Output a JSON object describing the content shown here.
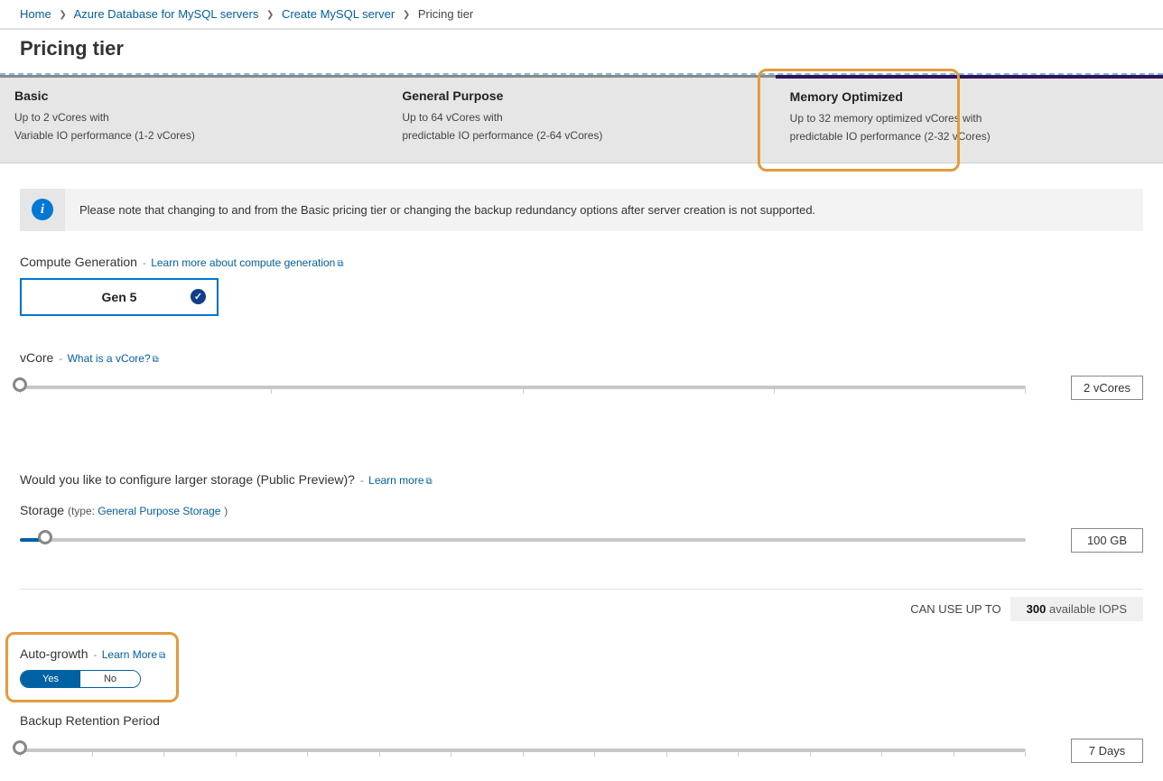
{
  "breadcrumb": {
    "items": [
      "Home",
      "Azure Database for MySQL servers",
      "Create MySQL server"
    ],
    "current": "Pricing tier"
  },
  "page_title": "Pricing tier",
  "tiers": [
    {
      "title": "Basic",
      "line1": "Up to 2 vCores with",
      "line2": "Variable IO performance (1-2 vCores)"
    },
    {
      "title": "General Purpose",
      "line1": "Up to 64 vCores with",
      "line2": "predictable IO performance (2-64 vCores)"
    },
    {
      "title": "Memory Optimized",
      "line1": "Up to 32 memory optimized vCores with",
      "line2": "predictable IO performance (2-32 vCores)"
    }
  ],
  "info_note": "Please note that changing to and from the Basic pricing tier or changing the backup redundancy options after server creation is not supported.",
  "compute": {
    "label": "Compute Generation",
    "link": "Learn more about compute generation",
    "value": "Gen 5"
  },
  "vcore": {
    "label": "vCore",
    "link": "What is a vCore?",
    "value": "2 vCores"
  },
  "large_storage": {
    "label": "Would you like to configure larger storage (Public Preview)?",
    "link": "Learn more"
  },
  "storage": {
    "label": "Storage",
    "type_prefix": "type:",
    "type_link": "General Purpose Storage",
    "value": "100 GB"
  },
  "iops": {
    "prefix": "CAN USE UP TO",
    "num": "300",
    "suffix": "available IOPS"
  },
  "autogrowth": {
    "label": "Auto-growth",
    "link": "Learn More",
    "yes": "Yes",
    "no": "No"
  },
  "backup": {
    "label": "Backup Retention Period",
    "value": "7 Days"
  }
}
